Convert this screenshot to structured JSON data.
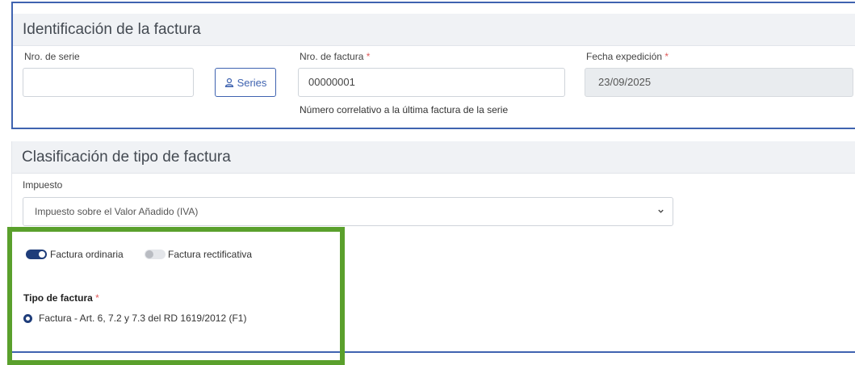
{
  "identificacion": {
    "header": "Identificación de la factura",
    "serie_label": "Nro. de serie",
    "serie_value": "",
    "series_button": "Series",
    "factura_label": "Nro. de factura",
    "factura_value": "00000001",
    "factura_help": "Número correlativo a la última factura de la serie",
    "fecha_label": "Fecha expedición",
    "fecha_value": "23/09/2025",
    "required_mark": "*"
  },
  "clasificacion": {
    "header": "Clasificación de tipo de factura",
    "impuesto_label": "Impuesto",
    "impuesto_value": "Impuesto sobre el Valor Añadido (IVA)",
    "toggle_ordinaria": "Factura ordinaria",
    "toggle_rectificativa": "Factura rectificativa",
    "tipo_label": "Tipo de factura",
    "tipo_option": "Factura - Art. 6, 7.2 y 7.3 del RD 1619/2012 (F1)"
  },
  "colors": {
    "accent": "#3f63b0",
    "toggle_on": "#1f3d7a",
    "highlight_frame": "#5aa02c",
    "required": "#e05a5a"
  }
}
